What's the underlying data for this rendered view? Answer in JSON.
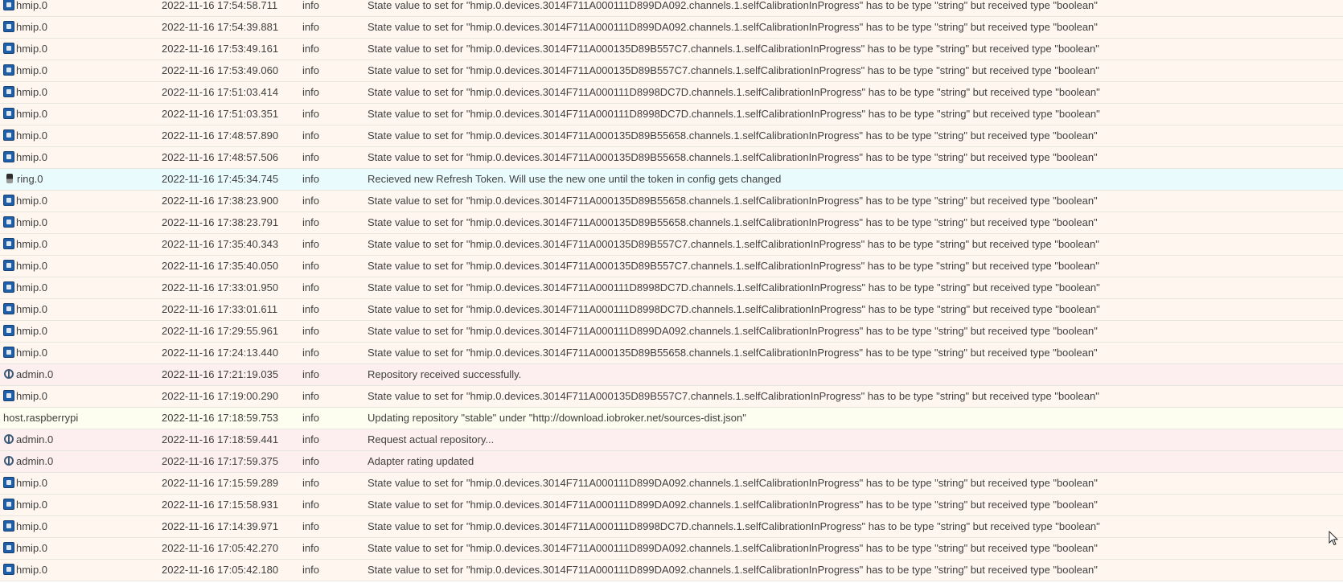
{
  "log": {
    "rows": [
      {
        "source": "hmip.0",
        "icon": "hmip-adapter-icon",
        "time": "2022-11-16 17:54:58.711",
        "severity": "info",
        "message": "State value to set for \"hmip.0.devices.3014F711A000111D899DA092.channels.1.selfCalibrationInProgress\" has to be type \"string\" but received type \"boolean\""
      },
      {
        "source": "hmip.0",
        "icon": "hmip-adapter-icon",
        "time": "2022-11-16 17:54:39.881",
        "severity": "info",
        "message": "State value to set for \"hmip.0.devices.3014F711A000111D899DA092.channels.1.selfCalibrationInProgress\" has to be type \"string\" but received type \"boolean\""
      },
      {
        "source": "hmip.0",
        "icon": "hmip-adapter-icon",
        "time": "2022-11-16 17:53:49.161",
        "severity": "info",
        "message": "State value to set for \"hmip.0.devices.3014F711A000135D89B557C7.channels.1.selfCalibrationInProgress\" has to be type \"string\" but received type \"boolean\""
      },
      {
        "source": "hmip.0",
        "icon": "hmip-adapter-icon",
        "time": "2022-11-16 17:53:49.060",
        "severity": "info",
        "message": "State value to set for \"hmip.0.devices.3014F711A000135D89B557C7.channels.1.selfCalibrationInProgress\" has to be type \"string\" but received type \"boolean\""
      },
      {
        "source": "hmip.0",
        "icon": "hmip-adapter-icon",
        "time": "2022-11-16 17:51:03.414",
        "severity": "info",
        "message": "State value to set for \"hmip.0.devices.3014F711A000111D8998DC7D.channels.1.selfCalibrationInProgress\" has to be type \"string\" but received type \"boolean\""
      },
      {
        "source": "hmip.0",
        "icon": "hmip-adapter-icon",
        "time": "2022-11-16 17:51:03.351",
        "severity": "info",
        "message": "State value to set for \"hmip.0.devices.3014F711A000111D8998DC7D.channels.1.selfCalibrationInProgress\" has to be type \"string\" but received type \"boolean\""
      },
      {
        "source": "hmip.0",
        "icon": "hmip-adapter-icon",
        "time": "2022-11-16 17:48:57.890",
        "severity": "info",
        "message": "State value to set for \"hmip.0.devices.3014F711A000135D89B55658.channels.1.selfCalibrationInProgress\" has to be type \"string\" but received type \"boolean\""
      },
      {
        "source": "hmip.0",
        "icon": "hmip-adapter-icon",
        "time": "2022-11-16 17:48:57.506",
        "severity": "info",
        "message": "State value to set for \"hmip.0.devices.3014F711A000135D89B55658.channels.1.selfCalibrationInProgress\" has to be type \"string\" but received type \"boolean\""
      },
      {
        "source": "ring.0",
        "icon": "ring-adapter-icon",
        "time": "2022-11-16 17:45:34.745",
        "severity": "info",
        "message": "Recieved new Refresh Token. Will use the new one until the token in config gets changed"
      },
      {
        "source": "hmip.0",
        "icon": "hmip-adapter-icon",
        "time": "2022-11-16 17:38:23.900",
        "severity": "info",
        "message": "State value to set for \"hmip.0.devices.3014F711A000135D89B55658.channels.1.selfCalibrationInProgress\" has to be type \"string\" but received type \"boolean\""
      },
      {
        "source": "hmip.0",
        "icon": "hmip-adapter-icon",
        "time": "2022-11-16 17:38:23.791",
        "severity": "info",
        "message": "State value to set for \"hmip.0.devices.3014F711A000135D89B55658.channels.1.selfCalibrationInProgress\" has to be type \"string\" but received type \"boolean\""
      },
      {
        "source": "hmip.0",
        "icon": "hmip-adapter-icon",
        "time": "2022-11-16 17:35:40.343",
        "severity": "info",
        "message": "State value to set for \"hmip.0.devices.3014F711A000135D89B557C7.channels.1.selfCalibrationInProgress\" has to be type \"string\" but received type \"boolean\""
      },
      {
        "source": "hmip.0",
        "icon": "hmip-adapter-icon",
        "time": "2022-11-16 17:35:40.050",
        "severity": "info",
        "message": "State value to set for \"hmip.0.devices.3014F711A000135D89B557C7.channels.1.selfCalibrationInProgress\" has to be type \"string\" but received type \"boolean\""
      },
      {
        "source": "hmip.0",
        "icon": "hmip-adapter-icon",
        "time": "2022-11-16 17:33:01.950",
        "severity": "info",
        "message": "State value to set for \"hmip.0.devices.3014F711A000111D8998DC7D.channels.1.selfCalibrationInProgress\" has to be type \"string\" but received type \"boolean\""
      },
      {
        "source": "hmip.0",
        "icon": "hmip-adapter-icon",
        "time": "2022-11-16 17:33:01.611",
        "severity": "info",
        "message": "State value to set for \"hmip.0.devices.3014F711A000111D8998DC7D.channels.1.selfCalibrationInProgress\" has to be type \"string\" but received type \"boolean\""
      },
      {
        "source": "hmip.0",
        "icon": "hmip-adapter-icon",
        "time": "2022-11-16 17:29:55.961",
        "severity": "info",
        "message": "State value to set for \"hmip.0.devices.3014F711A000111D899DA092.channels.1.selfCalibrationInProgress\" has to be type \"string\" but received type \"boolean\""
      },
      {
        "source": "hmip.0",
        "icon": "hmip-adapter-icon",
        "time": "2022-11-16 17:24:13.440",
        "severity": "info",
        "message": "State value to set for \"hmip.0.devices.3014F711A000135D89B55658.channels.1.selfCalibrationInProgress\" has to be type \"string\" but received type \"boolean\""
      },
      {
        "source": "admin.0",
        "icon": "admin-adapter-icon",
        "time": "2022-11-16 17:21:19.035",
        "severity": "info",
        "message": "Repository received successfully."
      },
      {
        "source": "hmip.0",
        "icon": "hmip-adapter-icon",
        "time": "2022-11-16 17:19:00.290",
        "severity": "info",
        "message": "State value to set for \"hmip.0.devices.3014F711A000135D89B557C7.channels.1.selfCalibrationInProgress\" has to be type \"string\" but received type \"boolean\""
      },
      {
        "source": "host.raspberrypi",
        "icon": "",
        "time": "2022-11-16 17:18:59.753",
        "severity": "info",
        "message": "Updating repository \"stable\" under \"http://download.iobroker.net/sources-dist.json\""
      },
      {
        "source": "admin.0",
        "icon": "admin-adapter-icon",
        "time": "2022-11-16 17:18:59.441",
        "severity": "info",
        "message": "Request actual repository..."
      },
      {
        "source": "admin.0",
        "icon": "admin-adapter-icon",
        "time": "2022-11-16 17:17:59.375",
        "severity": "info",
        "message": "Adapter rating updated"
      },
      {
        "source": "hmip.0",
        "icon": "hmip-adapter-icon",
        "time": "2022-11-16 17:15:59.289",
        "severity": "info",
        "message": "State value to set for \"hmip.0.devices.3014F711A000111D899DA092.channels.1.selfCalibrationInProgress\" has to be type \"string\" but received type \"boolean\""
      },
      {
        "source": "hmip.0",
        "icon": "hmip-adapter-icon",
        "time": "2022-11-16 17:15:58.931",
        "severity": "info",
        "message": "State value to set for \"hmip.0.devices.3014F711A000111D899DA092.channels.1.selfCalibrationInProgress\" has to be type \"string\" but received type \"boolean\""
      },
      {
        "source": "hmip.0",
        "icon": "hmip-adapter-icon",
        "time": "2022-11-16 17:14:39.971",
        "severity": "info",
        "message": "State value to set for \"hmip.0.devices.3014F711A000111D8998DC7D.channels.1.selfCalibrationInProgress\" has to be type \"string\" but received type \"boolean\""
      },
      {
        "source": "hmip.0",
        "icon": "hmip-adapter-icon",
        "time": "2022-11-16 17:05:42.270",
        "severity": "info",
        "message": "State value to set for \"hmip.0.devices.3014F711A000111D899DA092.channels.1.selfCalibrationInProgress\" has to be type \"string\" but received type \"boolean\""
      },
      {
        "source": "hmip.0",
        "icon": "hmip-adapter-icon",
        "time": "2022-11-16 17:05:42.180",
        "severity": "info",
        "message": "State value to set for \"hmip.0.devices.3014F711A000111D899DA092.channels.1.selfCalibrationInProgress\" has to be type \"string\" but received type \"boolean\""
      }
    ]
  },
  "row_colors": {
    "hmip": "#fff7ef",
    "ring": "#eafbfe",
    "admin": "#fdefef",
    "host": "#fefef0"
  },
  "cursor": {
    "icon": "mouse-pointer-icon"
  }
}
